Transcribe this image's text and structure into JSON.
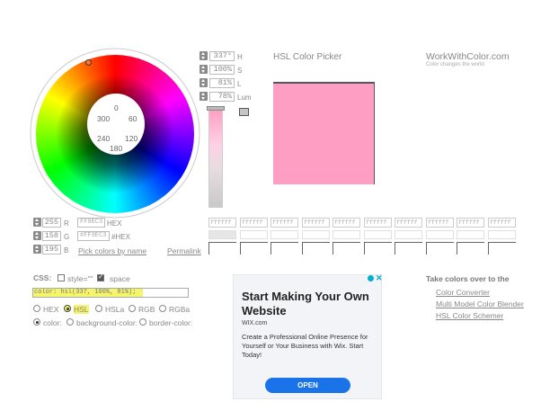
{
  "header": {
    "title": "HSL Color Picker",
    "brand": "WorkWithColor.com",
    "brand_tagline": "Color changes the world"
  },
  "wheel": {
    "labels": [
      "0",
      "60",
      "120",
      "180",
      "240",
      "300"
    ]
  },
  "hsl_fields": [
    {
      "value": "337°",
      "label": "H"
    },
    {
      "value": "100%",
      "label": "S"
    },
    {
      "value": "81%",
      "label": "L"
    },
    {
      "value": "78%",
      "label": "Lum"
    }
  ],
  "rgb_fields": [
    {
      "value": "255",
      "label": "R"
    },
    {
      "value": "158",
      "label": "G"
    },
    {
      "value": "195",
      "label": "B"
    }
  ],
  "hex": {
    "hex_value": "FF9EC3",
    "hex_label": "HEX",
    "hash_value": "#FF9EC3",
    "hash_label": "#HEX",
    "pick_link": "Pick colors by name",
    "permalink": "Permalink"
  },
  "palette": {
    "placeholder": "ffffff"
  },
  "css": {
    "label": "CSS:",
    "style_label": "style=\"\"",
    "space_label": "space",
    "output": "color: hsl(337, 100%, 81%);",
    "formats": [
      "HEX",
      "HSL",
      "HSLa",
      "RGB",
      "RGBa"
    ],
    "properties": [
      "color:",
      "background-color:",
      "border-color:"
    ]
  },
  "ad": {
    "title": "Start Making Your Own Website",
    "domain": "WIX.com",
    "body": "Create a Professional Online Presence for Yourself or Your Business with Wix. Start Today!",
    "button": "OPEN",
    "close": "✕"
  },
  "take": {
    "heading": "Take colors over to the",
    "links": [
      "Color Converter",
      "Multi Model Color Blender",
      "HSL Color Schemer"
    ]
  },
  "colors": {
    "selected": "#ff9ec3",
    "accent": "#1a73e8",
    "highlight": "#f5f56b"
  }
}
